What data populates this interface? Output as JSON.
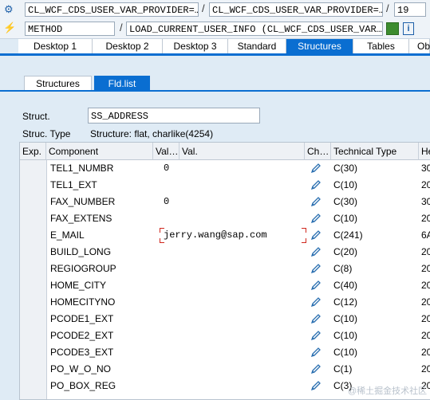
{
  "toolbar1": {
    "class_name": "CL_WCF_CDS_USER_VAR_PROVIDER=…",
    "class_name2": "CL_WCF_CDS_USER_VAR_PROVIDER=…",
    "line_no": "19"
  },
  "toolbar2": {
    "kind": "METHOD",
    "method_name": "LOAD_CURRENT_USER_INFO (CL_WCF_CDS_USER_VAR…"
  },
  "tabs": [
    "Desktop 1",
    "Desktop 2",
    "Desktop 3",
    "Standard",
    "Structures",
    "Tables",
    "Ob"
  ],
  "active_tab": "Structures",
  "subtabs": [
    "Structures",
    "Fld.list"
  ],
  "struct": {
    "label": "Struct.",
    "value": "SS_ADDRESS",
    "type_label": "Struc. Type",
    "type_value": "Structure: flat, charlike(4254)"
  },
  "columns": {
    "exp": "Exp.",
    "component": "Component",
    "valtype": "Val…",
    "val": "Val.",
    "change": "Ch…",
    "techtype": "Technical Type",
    "he": "He"
  },
  "rows": [
    {
      "component": "TEL1_NUMBR",
      "val": "0",
      "tech": "C(30)",
      "he": "30"
    },
    {
      "component": "TEL1_EXT",
      "val": "",
      "tech": "C(10)",
      "he": "20"
    },
    {
      "component": "FAX_NUMBER",
      "val": "0",
      "tech": "C(30)",
      "he": "30"
    },
    {
      "component": "FAX_EXTENS",
      "val": "",
      "tech": "C(10)",
      "he": "20"
    },
    {
      "component": "E_MAIL",
      "val": "jerry.wang@sap.com",
      "tech": "C(241)",
      "he": "6A"
    },
    {
      "component": "BUILD_LONG",
      "val": "",
      "tech": "C(20)",
      "he": "20"
    },
    {
      "component": "REGIOGROUP",
      "val": "",
      "tech": "C(8)",
      "he": "20"
    },
    {
      "component": "HOME_CITY",
      "val": "",
      "tech": "C(40)",
      "he": "20"
    },
    {
      "component": "HOMECITYNO",
      "val": "",
      "tech": "C(12)",
      "he": "20"
    },
    {
      "component": "PCODE1_EXT",
      "val": "",
      "tech": "C(10)",
      "he": "20"
    },
    {
      "component": "PCODE2_EXT",
      "val": "",
      "tech": "C(10)",
      "he": "20"
    },
    {
      "component": "PCODE3_EXT",
      "val": "",
      "tech": "C(10)",
      "he": "20"
    },
    {
      "component": "PO_W_O_NO",
      "val": "",
      "tech": "C(1)",
      "he": "20"
    },
    {
      "component": "PO_BOX_REG",
      "val": "",
      "tech": "C(3)",
      "he": "20"
    }
  ],
  "watermark": "@稀土掘金技术社区",
  "colors": {
    "accent": "#0a6ed1",
    "pencil": "#2a6fb0",
    "focus": "#d0271d"
  }
}
